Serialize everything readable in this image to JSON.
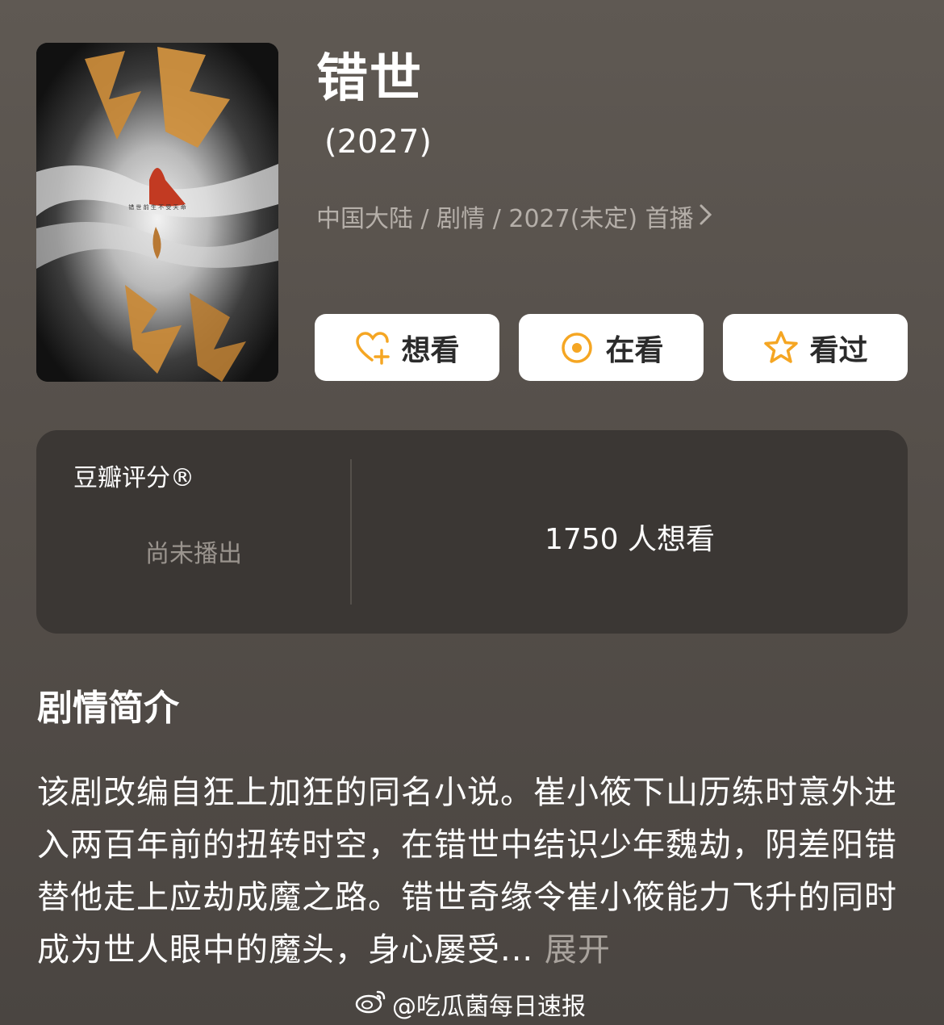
{
  "show": {
    "title": "错世",
    "year": "(2027)",
    "meta": "中国大陆 / 剧情 / 2027(未定) 首播",
    "poster_tagline": "错 世 前 生 不 受 天 命"
  },
  "actions": [
    {
      "label": "想看",
      "icon": "heart-plus-icon"
    },
    {
      "label": "在看",
      "icon": "target-circle-icon"
    },
    {
      "label": "看过",
      "icon": "star-outline-icon"
    }
  ],
  "rating": {
    "label": "豆瓣评分®",
    "status": "尚未播出",
    "want_count": "1750 人想看"
  },
  "synopsis": {
    "title": "剧情简介",
    "text": "该剧改编自狂上加狂的同名小说。崔小筱下山历练时意外进入两百年前的扭转时空，在错世中结识少年魏劫，阴差阳错替他走上应劫成魔之路。错世奇缘令崔小筱能力飞升的同时成为世人眼中的魔头，身心屡受...",
    "more": "展开"
  },
  "watermark": "@吃瓜菌每日速报",
  "colors": {
    "accent": "#f5a623",
    "background": "#5a544f",
    "card": "#3b3734"
  }
}
